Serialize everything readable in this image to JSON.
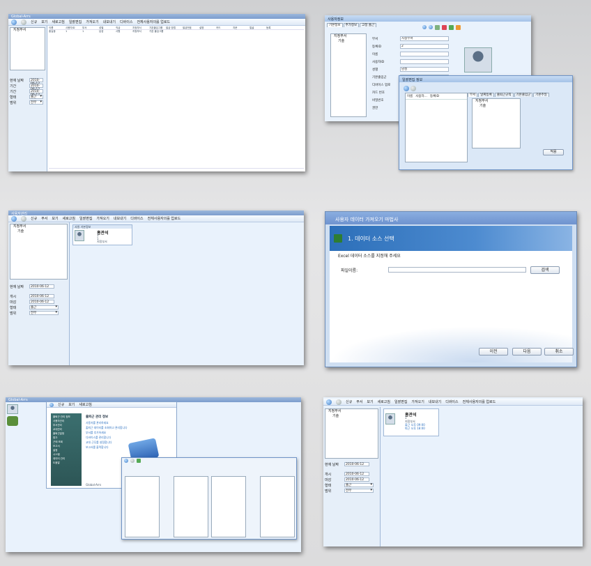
{
  "shot1": {
    "title": "Global-Arrs",
    "toolbar": [
      "신규",
      "보기",
      "새로고침",
      "일괄편집",
      "가져오기",
      "내보내기",
      "디바이스",
      "전체사용자의를 업로드"
    ],
    "columns": [
      "이름",
      "사용자ID",
      "부서",
      "성별",
      "직급",
      "지정부서",
      "기본출입그룹",
      "발급 방법",
      "발급번호",
      "설명",
      "카드",
      "지문",
      "얼굴",
      "등록"
    ],
    "row": [
      "홍길동",
      "1",
      "1",
      "남성",
      "사원",
      "지정부서",
      "기본 출입그룹",
      "",
      "",
      "",
      "",
      "",
      "",
      ""
    ],
    "tree_root": "지정부서",
    "date_label": "현재 날짜",
    "date_value": "2010-06-12",
    "period_from_label": "기간",
    "period_to_label": "기간",
    "status_label": "형태",
    "status_value": "출근",
    "range_label": "범위",
    "range_value": "전부"
  },
  "shot2": {
    "title": "사용자정보",
    "tabs": [
      "기본정보",
      "추가정보",
      "고정 출근"
    ],
    "tree": [
      "지정부서",
      "기술"
    ],
    "fields": [
      {
        "label": "부서",
        "value": "지정부서"
      },
      {
        "label": "등록ID",
        "value": "2"
      },
      {
        "label": "이름",
        "value": ""
      },
      {
        "label": "사용자ID",
        "value": ""
      },
      {
        "label": "성별",
        "value": "남성"
      },
      {
        "label": "기본출입군",
        "value": "근무시간 ▾ Monica ▾"
      },
      {
        "label": "디바이스 업로",
        "value": ""
      },
      {
        "label": "카드 번호",
        "value": ""
      },
      {
        "label": "비밀번호",
        "value": ""
      },
      {
        "label": "권한",
        "value": ""
      }
    ],
    "time_range": "09:00 - 12:00",
    "sub_title": "일괄편집 정보",
    "sub_tabs": [
      "부서",
      "날짜등록",
      "출퇴근규칙",
      "기본출입군",
      "기본주일"
    ],
    "sub_cols": [
      "이름",
      "사용자...",
      "등록ID"
    ],
    "sub_tree": [
      "지정부서",
      "기술"
    ],
    "sub_button": "적용"
  },
  "shot3": {
    "title": "사용자관리",
    "toolbar": [
      "신규",
      "부서",
      "보기",
      "새로고침",
      "일괄편집",
      "가져오기",
      "내보내기",
      "디바이스",
      "전체사용자의를 업로드"
    ],
    "tree": [
      "지정부서",
      "기술"
    ],
    "card_head": "사원 기본정보",
    "card_name": "홍관석",
    "card_lines": [
      "1",
      "1",
      "지정부서"
    ],
    "date_label": "현재 날짜",
    "date_value": "2010-06-12",
    "from_label": "개시",
    "from_value": "2010-06-12",
    "to_label": "마감",
    "to_value": "2010-06-12",
    "status_label": "형태",
    "status_value": "출근",
    "range_label": "범위",
    "range_value": "전부"
  },
  "shot4": {
    "title": "사용자 데이터 가져오기 마법사",
    "step": "1. 데이터 소스 선택",
    "prompt": "Excel 데이터 소스를 지정해 주세요",
    "file_label": "파일이름:",
    "browse": "검색",
    "back": "이전",
    "next": "다음",
    "cancel": "취소"
  },
  "shot5": {
    "title": "Global-Arrs",
    "toolbar": [
      "신규",
      "보기",
      "새로고침"
    ],
    "side_items": [
      "출퇴근 관리 정보",
      "사용자관리",
      "부서관리",
      "교대관리",
      "출퇴근일정",
      "휴가",
      "근태 조회",
      "보고서",
      "설정",
      "시스템",
      "데이터 관리",
      "도움말"
    ],
    "panel_title": "출퇴근 관리 정보",
    "panel_lines": [
      "사용자를 관리하세요",
      "출퇴근 데이터를 조회하고 관리합니다",
      "부서를 추가하세요",
      "디바이스를 관리합니다",
      "교대 근무를 설정합니다",
      "보고서를 출력합니다"
    ],
    "footer": "Global-Arrs"
  },
  "shot6": {
    "toolbar": [
      "신규",
      "부서",
      "보기",
      "새로고침",
      "일괄편집",
      "가져오기",
      "내보내기",
      "디바이스",
      "전체사용자의를 업로드"
    ],
    "tree": [
      "지정부서",
      "기술"
    ],
    "card_name": "홍관석",
    "card_lines": [
      "1",
      "지정부서",
      "출근 오후 09:00",
      "퇴근 오후 18:00"
    ],
    "date_label": "현재 날짜",
    "date_value": "2010-06-12",
    "from_label": "개시",
    "from_value": "2010-06-12",
    "to_label": "마감",
    "to_value": "2010-06-12",
    "status_label": "형태",
    "status_value": "출근",
    "range_label": "범위",
    "range_value": "전부"
  }
}
